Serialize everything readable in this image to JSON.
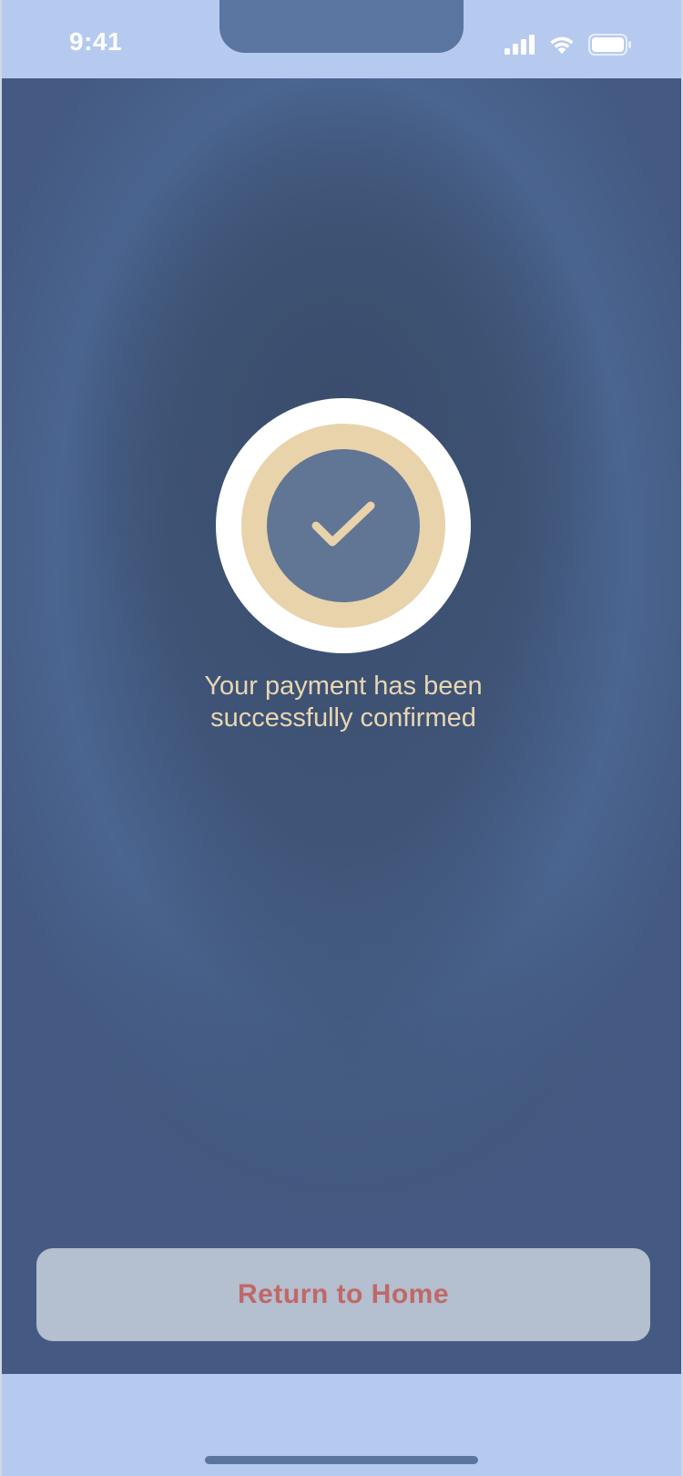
{
  "status_bar": {
    "time": "9:41",
    "icons": [
      "signal-icon",
      "wifi-icon",
      "battery-icon"
    ]
  },
  "confirmation": {
    "icon": "checkmark-icon",
    "message_line_1": "Your payment has been",
    "message_line_2": "successfully confirmed"
  },
  "actions": {
    "return_home_label": "Return to Home"
  },
  "colors": {
    "accent_gold": "#e8d3ab",
    "button_text": "#c06867",
    "background_navy": "#3f5477",
    "chrome_light_blue": "#b6caf0"
  }
}
